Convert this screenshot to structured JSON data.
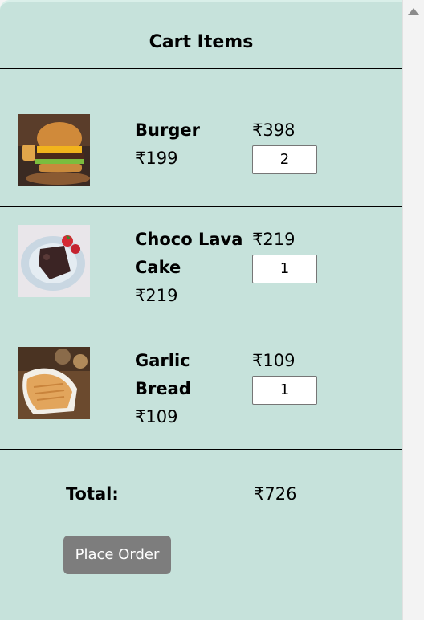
{
  "cart": {
    "title": "Cart Items",
    "items": [
      {
        "name_line1": "Burger",
        "name_line2": "",
        "unit_price": "₹199",
        "line_total": "₹398",
        "quantity": "2",
        "image_icon": "burger-image"
      },
      {
        "name_line1": "Choco Lava",
        "name_line2": "Cake",
        "unit_price": "₹219",
        "line_total": "₹219",
        "quantity": "1",
        "image_icon": "cake-image"
      },
      {
        "name_line1": "Garlic",
        "name_line2": "Bread",
        "unit_price": "₹109",
        "line_total": "₹109",
        "quantity": "1",
        "image_icon": "bread-image"
      }
    ],
    "total_label": "Total:",
    "total_value": "₹726",
    "place_order_label": "Place Order"
  },
  "colors": {
    "panel": "#c6e2db",
    "button": "#7d7d7d"
  }
}
